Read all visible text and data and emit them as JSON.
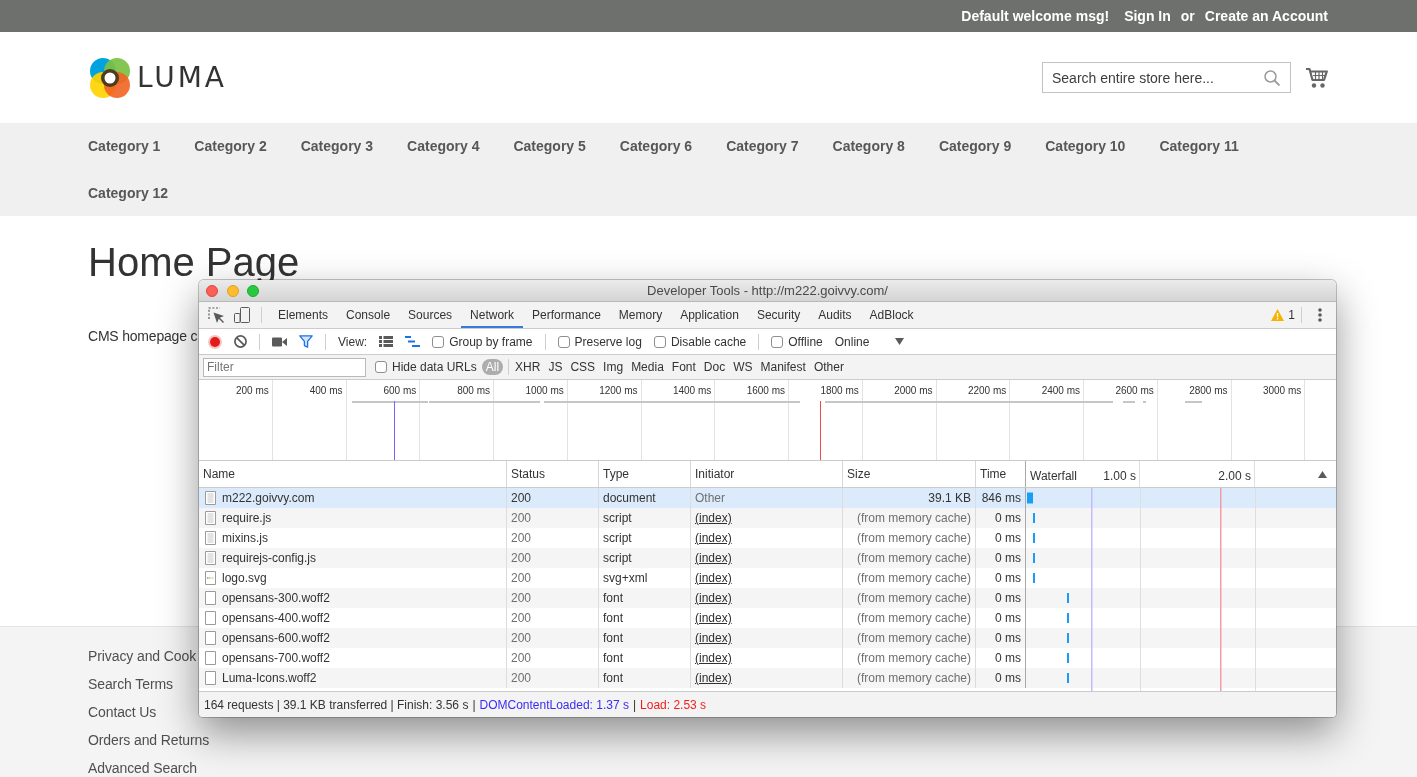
{
  "store": {
    "top_bar": {
      "welcome": "Default welcome msg!",
      "sign_in": "Sign In",
      "separator": "or",
      "create_account": "Create an Account"
    },
    "header": {
      "logo_text": "LUMA",
      "search": {
        "placeholder": "Search entire store here..."
      }
    },
    "nav": [
      "Category 1",
      "Category 2",
      "Category 3",
      "Category 4",
      "Category 5",
      "Category 6",
      "Category 7",
      "Category 8",
      "Category 9",
      "Category 10",
      "Category 11",
      "Category 12"
    ],
    "page_title": "Home Page",
    "content": "CMS homepage c",
    "footer_links": [
      "Privacy and Cook",
      "Search Terms",
      "Contact Us",
      "Orders and Returns",
      "Advanced Search"
    ]
  },
  "devtools": {
    "title": "Developer Tools - http://m222.goivvy.com/",
    "tabs": [
      {
        "label": "Elements",
        "selected": false
      },
      {
        "label": "Console",
        "selected": false
      },
      {
        "label": "Sources",
        "selected": false
      },
      {
        "label": "Network",
        "selected": true
      },
      {
        "label": "Performance",
        "selected": false
      },
      {
        "label": "Memory",
        "selected": false
      },
      {
        "label": "Application",
        "selected": false
      },
      {
        "label": "Security",
        "selected": false
      },
      {
        "label": "Audits",
        "selected": false
      },
      {
        "label": "AdBlock",
        "selected": false
      }
    ],
    "warnings": "1",
    "toolbar": {
      "recording": true,
      "filter_active": true,
      "view_label": "View:",
      "views": [
        {
          "kind": "rows",
          "selected": false
        },
        {
          "kind": "overview",
          "selected": true
        }
      ],
      "option_groups": [
        [
          {
            "label": "Group by frame",
            "checked": false
          }
        ],
        [
          {
            "label": "Preserve log",
            "checked": false
          },
          {
            "label": "Disable cache",
            "checked": false
          }
        ],
        [
          {
            "label": "Offline",
            "checked": false
          }
        ]
      ],
      "throttling": "Online"
    },
    "filter_bar": {
      "filter": {
        "placeholder": "Filter"
      },
      "hide_data_urls": {
        "label": "Hide data URLs",
        "checked": false
      },
      "types": [
        {
          "label": "All",
          "selected": true
        },
        {
          "label": "XHR",
          "selected": false
        },
        {
          "label": "JS",
          "selected": false
        },
        {
          "label": "CSS",
          "selected": false
        },
        {
          "label": "Img",
          "selected": false
        },
        {
          "label": "Media",
          "selected": false
        },
        {
          "label": "Font",
          "selected": false
        },
        {
          "label": "Doc",
          "selected": false
        },
        {
          "label": "WS",
          "selected": false
        },
        {
          "label": "Manifest",
          "selected": false
        },
        {
          "label": "Other",
          "selected": false
        }
      ]
    },
    "overview": {
      "ticks": [
        "200 ms",
        "400 ms",
        "600 ms",
        "800 ms",
        "1000 ms",
        "1200 ms",
        "1400 ms",
        "1600 ms",
        "1800 ms",
        "2000 ms",
        "2200 ms",
        "2400 ms",
        "2600 ms",
        "2800 ms",
        "3000 ms"
      ]
    },
    "table": {
      "columns": [
        "Name",
        "Status",
        "Type",
        "Initiator",
        "Size",
        "Time"
      ],
      "waterfall": {
        "label": "Waterfall",
        "ticks": [
          "1.00 s",
          "2.00 s"
        ]
      },
      "rows": [
        {
          "kind": "document",
          "name": "m222.goivvy.com",
          "status": "200",
          "type": "document",
          "initiator": {
            "text": "Other",
            "link": false
          },
          "size": "39.1 KB",
          "time": "846 ms",
          "cached": false,
          "selected": true
        },
        {
          "kind": "document",
          "name": "require.js",
          "status": "200",
          "type": "script",
          "initiator": {
            "text": "(index)",
            "link": true
          },
          "size": "(from memory cache)",
          "time": "0 ms",
          "cached": true,
          "selected": false
        },
        {
          "kind": "document",
          "name": "mixins.js",
          "status": "200",
          "type": "script",
          "initiator": {
            "text": "(index)",
            "link": true
          },
          "size": "(from memory cache)",
          "time": "0 ms",
          "cached": true,
          "selected": false
        },
        {
          "kind": "document",
          "name": "requirejs-config.js",
          "status": "200",
          "type": "script",
          "initiator": {
            "text": "(index)",
            "link": true
          },
          "size": "(from memory cache)",
          "time": "0 ms",
          "cached": true,
          "selected": false
        },
        {
          "kind": "image",
          "name": "logo.svg",
          "status": "200",
          "type": "svg+xml",
          "initiator": {
            "text": "(index)",
            "link": true
          },
          "size": "(from memory cache)",
          "time": "0 ms",
          "cached": true,
          "selected": false
        },
        {
          "kind": "blank",
          "name": "opensans-300.woff2",
          "status": "200",
          "type": "font",
          "initiator": {
            "text": "(index)",
            "link": true
          },
          "size": "(from memory cache)",
          "time": "0 ms",
          "cached": true,
          "selected": false
        },
        {
          "kind": "blank",
          "name": "opensans-400.woff2",
          "status": "200",
          "type": "font",
          "initiator": {
            "text": "(index)",
            "link": true
          },
          "size": "(from memory cache)",
          "time": "0 ms",
          "cached": true,
          "selected": false
        },
        {
          "kind": "blank",
          "name": "opensans-600.woff2",
          "status": "200",
          "type": "font",
          "initiator": {
            "text": "(index)",
            "link": true
          },
          "size": "(from memory cache)",
          "time": "0 ms",
          "cached": true,
          "selected": false
        },
        {
          "kind": "blank",
          "name": "opensans-700.woff2",
          "status": "200",
          "type": "font",
          "initiator": {
            "text": "(index)",
            "link": true
          },
          "size": "(from memory cache)",
          "time": "0 ms",
          "cached": true,
          "selected": false
        },
        {
          "kind": "blank",
          "name": "Luma-Icons.woff2",
          "status": "200",
          "type": "font",
          "initiator": {
            "text": "(index)",
            "link": true
          },
          "size": "(from memory cache)",
          "time": "0 ms",
          "cached": true,
          "selected": false
        }
      ]
    },
    "status_bar": [
      {
        "kind": "summary",
        "text": "164 requests | 39.1 KB transferred | Finish: 3.56 s"
      },
      {
        "kind": "separator",
        "text": "|"
      },
      {
        "kind": "dom",
        "text": "DOMContentLoaded: 1.37 s"
      },
      {
        "kind": "separator",
        "text": "|"
      },
      {
        "kind": "load",
        "text": "Load: 2.53 s"
      }
    ]
  }
}
